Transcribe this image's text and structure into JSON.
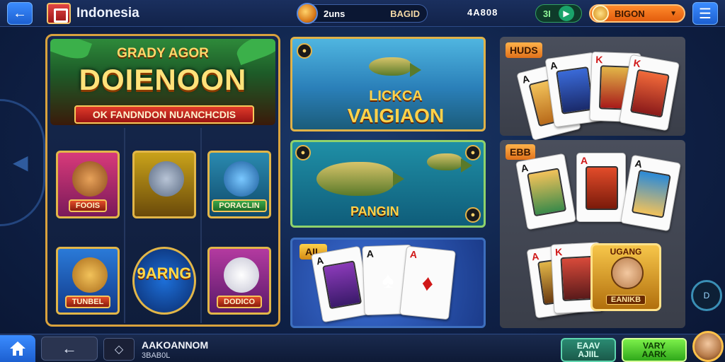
{
  "header": {
    "brand": "Indonesia",
    "search_label": "2uns",
    "search_value": "BAGID",
    "coin_amount": "4A808",
    "level_label": "3I",
    "wallet_label": "BIGON"
  },
  "featured": {
    "banner_sub": "GRADY AGOR",
    "banner_title": "DOIENOON",
    "banner_ribbon": "OK FANDNDON NUANCHCDIS",
    "tiles": [
      {
        "label": "FOOIS"
      },
      {
        "label": ""
      },
      {
        "label": "PORACLIN"
      },
      {
        "label": "TUNBEL"
      },
      {
        "big": "9ARNG"
      },
      {
        "label": "DODICO"
      }
    ]
  },
  "middle": {
    "card1_line1": "LICKCA",
    "card1_line2": "VAIGIAON",
    "card2_label": "PANGIN",
    "card3_badge": "AIL"
  },
  "right": {
    "panel1_badge": "HUDS",
    "panel2_badge": "EBB",
    "frame_header": "UGANG",
    "frame_label": "EANIKB"
  },
  "footer": {
    "account_name": "AAKOANNOM",
    "account_id": "3BAB0L",
    "btn_left_l1": "EAAV",
    "btn_left_l2": "AJIIL",
    "btn_right_l1": "VARY",
    "btn_right_l2": "AARK"
  },
  "colors": {
    "accent_blue": "#2a74e8",
    "gold": "#e2b648",
    "wallet_orange": "#f27a1e",
    "success_green": "#3cc82a"
  }
}
